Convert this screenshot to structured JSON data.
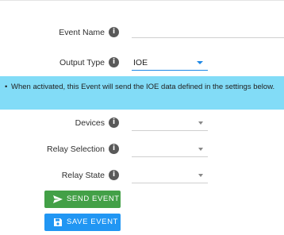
{
  "form": {
    "event_name": {
      "label": "Event Name",
      "value": ""
    },
    "output_type": {
      "label": "Output Type",
      "value": "IOE"
    },
    "notice": {
      "bullet": "•",
      "text": "When activated, this Event will send the IOE data defined in the settings below."
    },
    "devices": {
      "label": "Devices",
      "value": ""
    },
    "relay_selection": {
      "label": "Relay Selection",
      "value": ""
    },
    "relay_state": {
      "label": "Relay State",
      "value": ""
    },
    "info_glyph": "i"
  },
  "buttons": {
    "send_event": {
      "label": "SEND EVENT",
      "icon": "send-icon",
      "color": "#43a047"
    },
    "save_event": {
      "label": "SAVE EVENT",
      "icon": "save-icon",
      "color": "#2196f3"
    }
  },
  "colors": {
    "notice_bg": "#82dcf7",
    "accent": "#1e88e5",
    "info_icon": "#595959"
  }
}
